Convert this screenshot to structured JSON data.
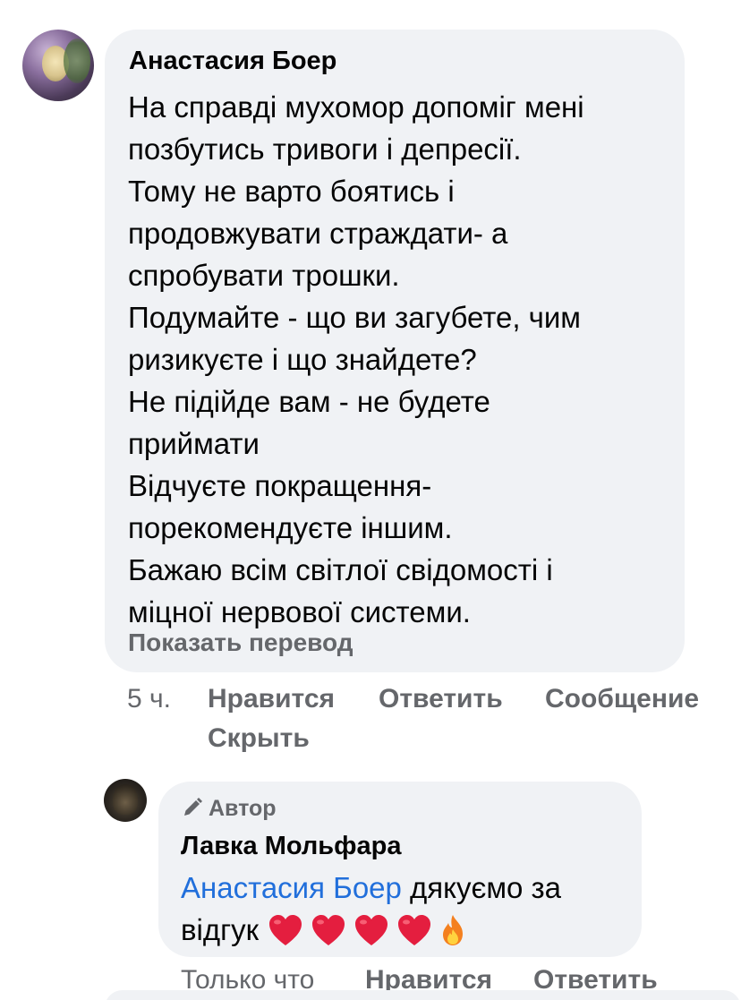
{
  "comment": {
    "author": "Анастасия Боер",
    "lines": [
      "На справді мухомор допоміг мені",
      "позбутись тривоги і депресії.",
      "Тому не варто боятись і",
      "продовжувати страждати- а",
      "спробувати трошки.",
      "Подумайте - що ви загубете, чим",
      "ризикуєте і що знайдете?",
      "Не підійде вам - не будете",
      "приймати",
      "Відчуєте покращення-",
      "порекомендуєте іншим.",
      "Бажаю всім світлої свідомості і",
      "міцної нервової системи."
    ],
    "translate_label": "Показать перевод",
    "time": "5 ч.",
    "like_label": "Нравится",
    "reply_label": "Ответить",
    "message_label": "Сообщение",
    "hide_label": "Скрыть"
  },
  "reply": {
    "badge_label": "Автор",
    "author": "Лавка Мольфара",
    "mention": "Анастасия Боер",
    "text_after_mention": " дякуємо за",
    "text_line2": "відгук",
    "emojis": [
      "heart-icon",
      "heart-icon",
      "heart-icon",
      "heart-icon",
      "fire-icon"
    ],
    "time": "Только что",
    "like_label": "Нравится",
    "reply_label": "Ответить"
  },
  "colors": {
    "bubble_bg": "#f0f2f5",
    "secondary_text": "#65676b",
    "mention": "#216fdb",
    "heart": "#e41e3f"
  }
}
